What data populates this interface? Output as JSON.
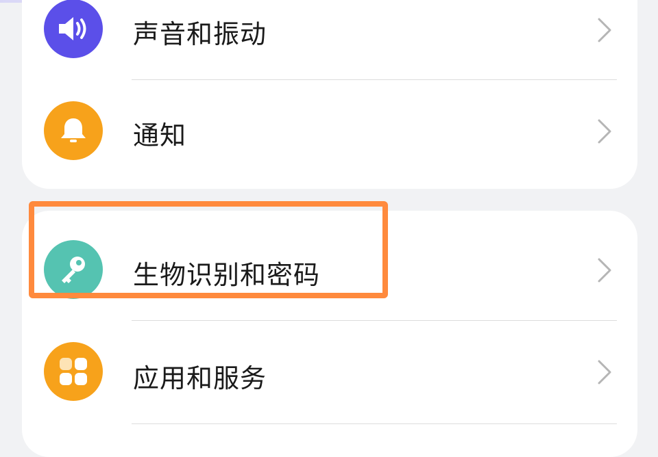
{
  "settings": {
    "group1": [
      {
        "label": "声音和振动",
        "icon": "speaker-icon",
        "color": "#5b4fe9"
      },
      {
        "label": "通知",
        "icon": "bell-icon",
        "color": "#f7a21b"
      }
    ],
    "group2": [
      {
        "label": "生物识别和密码",
        "icon": "key-icon",
        "color": "#55c3b1"
      },
      {
        "label": "应用和服务",
        "icon": "apps-grid-icon",
        "color": "#f7a21b"
      }
    ]
  },
  "annotation": {
    "highlight_color": "#ff8a3d",
    "highlight_target": "生物识别和密码"
  }
}
